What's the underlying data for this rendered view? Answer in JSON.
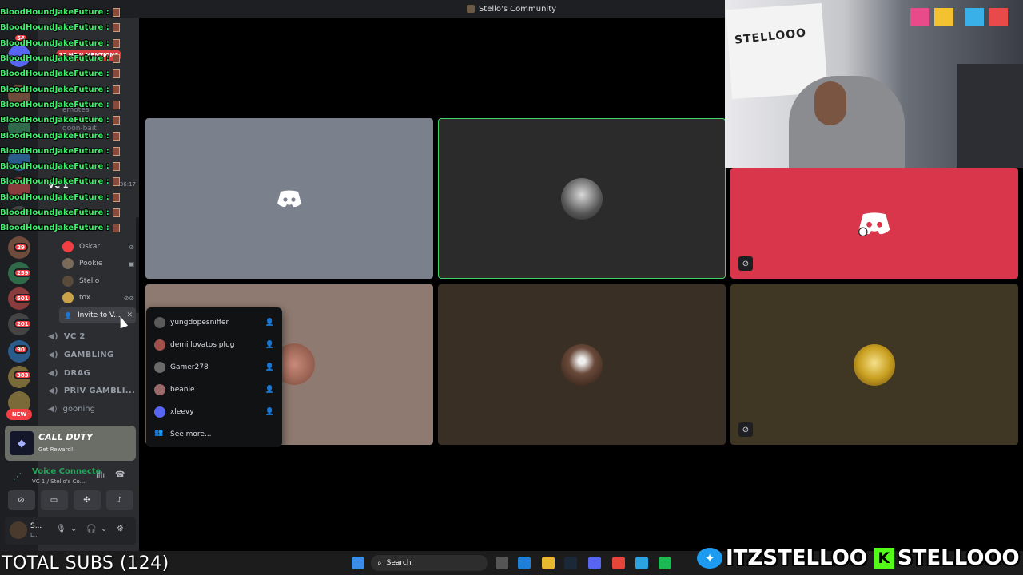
{
  "window": {
    "title": "Stello's Community"
  },
  "chat_overlay": {
    "lines": [
      "BloodHoundJakeFuture :",
      "BloodHoundJakeFuture :",
      "BloodHoundJakeFuture :",
      "BloodHoundJakeFuture :",
      "BloodHoundJakeFuture :",
      "BloodHoundJakeFuture :",
      "BloodHoundJakeFuture :",
      "BloodHoundJakeFuture :",
      "BloodHoundJakeFuture :",
      "BloodHoundJakeFuture :",
      "BloodHoundJakeFuture :",
      "BloodHoundJakeFuture :",
      "BloodHoundJakeFuture :",
      "BloodHoundJakeFuture :",
      "BloodHoundJakeFuture :"
    ]
  },
  "server_rail": {
    "badges": [
      "54",
      "29",
      "259",
      "501",
      "201",
      "90",
      "383"
    ],
    "new_label": "NEW"
  },
  "channels": {
    "mentions_pill": "29 NEW MENTIONS",
    "ghost": [
      "emotes",
      "goon-bait"
    ],
    "voice_header": "VC 1",
    "voice_timer": "36:17",
    "voice_users": [
      {
        "name": "Oskar",
        "color": "#f23f43"
      },
      {
        "name": "Pookie",
        "color": "#7a6a5a"
      },
      {
        "name": "Stello",
        "color": "#5a4a3a"
      },
      {
        "name": "tox",
        "color": "#c9a24a"
      }
    ],
    "invite_label": "Invite to V...",
    "voice_channels": [
      {
        "name": "VC 2"
      },
      {
        "name": "GAMBLING"
      },
      {
        "name": "DRAG"
      },
      {
        "name": "PRIV GAMBLI..."
      },
      {
        "name": "gooning"
      }
    ]
  },
  "promo": {
    "title": "CALL DUTY",
    "subtitle": "Get Reward!"
  },
  "voice_panel": {
    "status": "Voice Connecte",
    "channel": "VC 1 / Stello's Co..."
  },
  "user_panel": {
    "name": "S...",
    "status": "L..."
  },
  "tiles": [
    {
      "bg": "#7b818c"
    },
    {
      "bg": "#2b2b2b",
      "border": "#3fd36a"
    },
    {
      "bg": "#d9364b"
    },
    {
      "bg": "#8e7a70"
    },
    {
      "bg": "#3a2f25"
    },
    {
      "bg": "#403624"
    }
  ],
  "invite_popup": {
    "items": [
      {
        "name": "yungdopesniffer",
        "color": "#5a5a5a"
      },
      {
        "name": "demi lovatos plug",
        "color": "#a0524a"
      },
      {
        "name": "Gamer278",
        "color": "#6a6a6a"
      },
      {
        "name": "beanie",
        "color": "#9a6a6a"
      },
      {
        "name": "xleevy",
        "color": "#5865f2"
      }
    ],
    "see_more": "See more..."
  },
  "webcam": {
    "box_text": "STELLOOO"
  },
  "taskbar": {
    "search_placeholder": "Search",
    "subs_text": "TOTAL SUBS (124)"
  },
  "socials": {
    "twitter": "ITZSTELLOO",
    "kick": "STELLOOO"
  }
}
